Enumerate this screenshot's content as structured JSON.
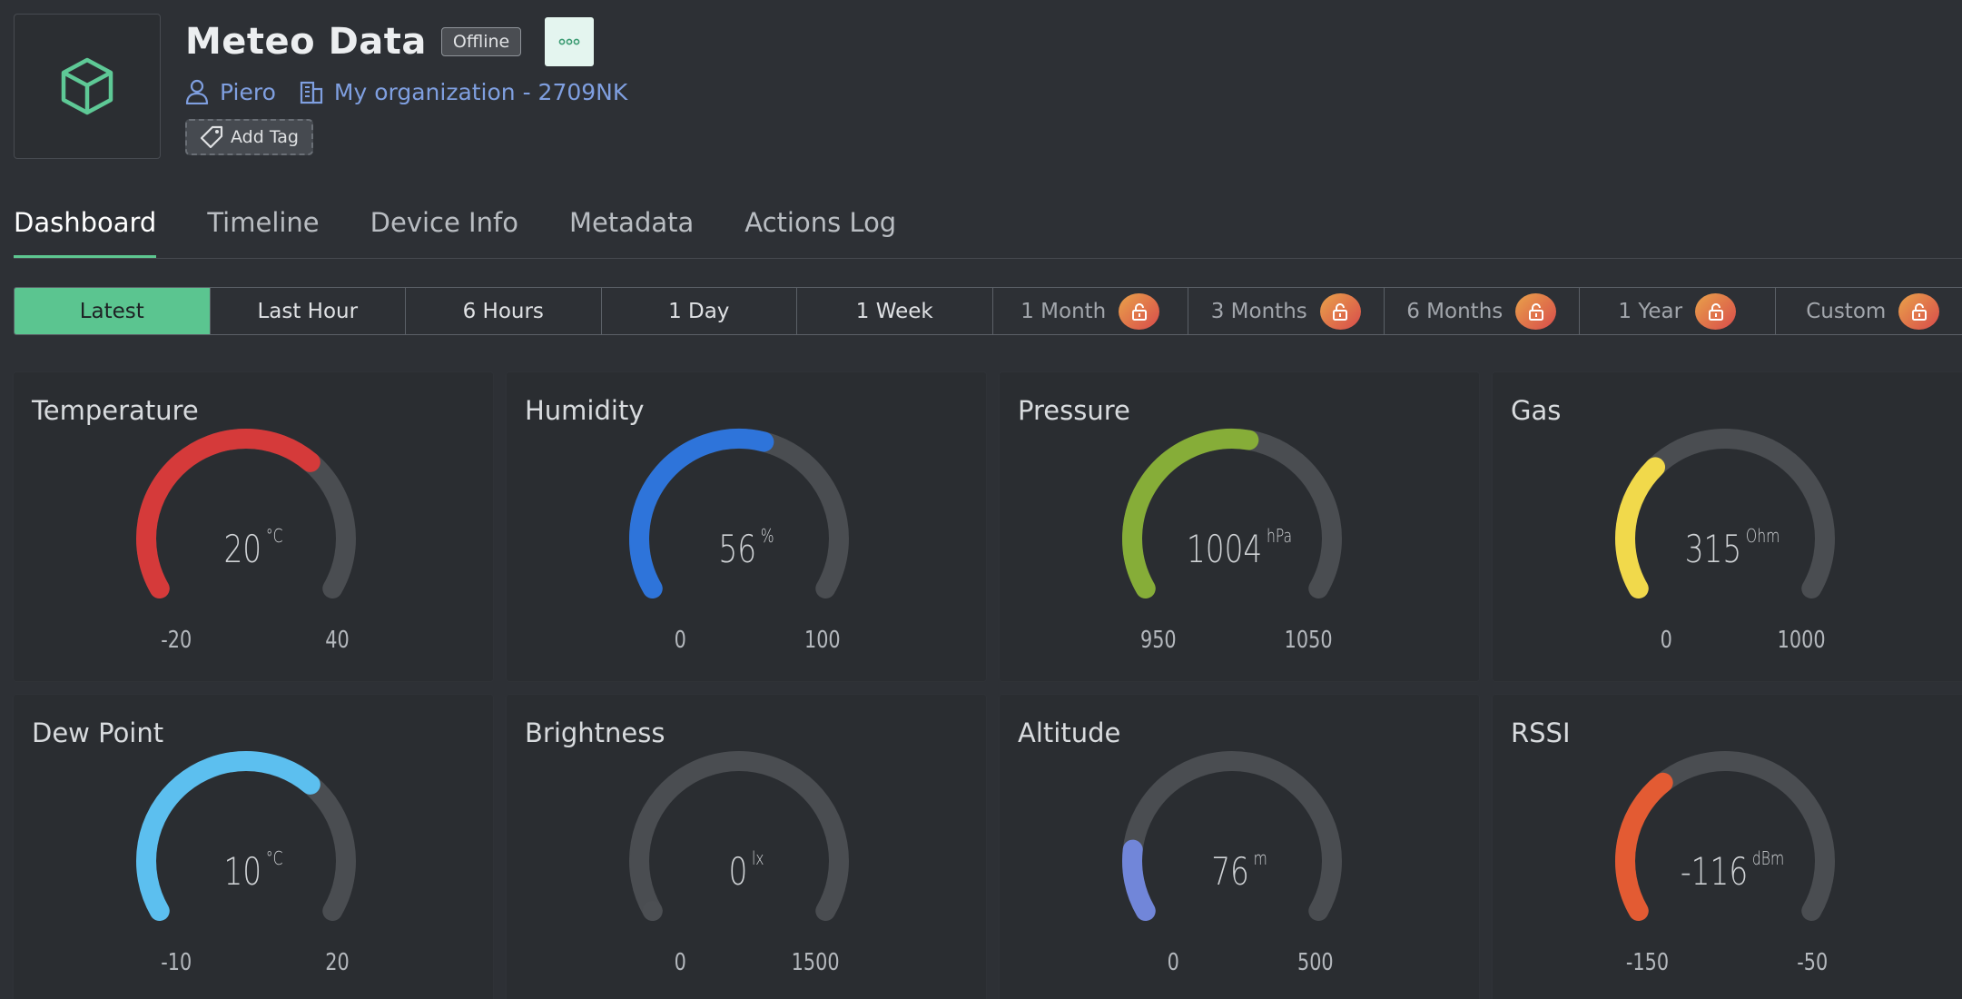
{
  "device": {
    "title": "Meteo Data",
    "status": "Offline",
    "owner": "Piero",
    "organization": "My organization - 2709NK",
    "add_tag_label": "Add Tag"
  },
  "tabs": [
    {
      "label": "Dashboard",
      "active": true
    },
    {
      "label": "Timeline"
    },
    {
      "label": "Device Info"
    },
    {
      "label": "Metadata"
    },
    {
      "label": "Actions Log"
    }
  ],
  "ranges": [
    {
      "label": "Latest",
      "active": true,
      "locked": false
    },
    {
      "label": "Last Hour",
      "locked": false
    },
    {
      "label": "6 Hours",
      "locked": false
    },
    {
      "label": "1 Day",
      "locked": false
    },
    {
      "label": "1 Week",
      "locked": false
    },
    {
      "label": "1 Month",
      "locked": true
    },
    {
      "label": "3 Months",
      "locked": true
    },
    {
      "label": "6 Months",
      "locked": true
    },
    {
      "label": "1 Year",
      "locked": true
    },
    {
      "label": "Custom",
      "locked": true
    }
  ],
  "gauges": [
    {
      "title": "Temperature",
      "value": "20",
      "unit": "°C",
      "min": "-20",
      "max": "40",
      "fraction": 0.667,
      "color": "#d53a3a"
    },
    {
      "title": "Humidity",
      "value": "56",
      "unit": "%",
      "min": "0",
      "max": "100",
      "fraction": 0.56,
      "color": "#2e74da"
    },
    {
      "title": "Pressure",
      "value": "1004",
      "unit": "hPa",
      "min": "950",
      "max": "1050",
      "fraction": 0.54,
      "color": "#86ad38"
    },
    {
      "title": "Gas",
      "value": "315",
      "unit": "Ohm",
      "min": "0",
      "max": "1000",
      "fraction": 0.315,
      "color": "#f1d94b"
    },
    {
      "title": "Dew Point",
      "value": "10",
      "unit": "°C",
      "min": "-10",
      "max": "20",
      "fraction": 0.667,
      "color": "#5cbfef"
    },
    {
      "title": "Brightness",
      "value": "0",
      "unit": "lx",
      "min": "0",
      "max": "1500",
      "fraction": 0.0,
      "color": "#4c4f53"
    },
    {
      "title": "Altitude",
      "value": "76",
      "unit": "m",
      "min": "0",
      "max": "500",
      "fraction": 0.152,
      "color": "#7186d9"
    },
    {
      "title": "RSSI",
      "value": "-116",
      "unit": "dBm",
      "min": "-150",
      "max": "-50",
      "fraction": 0.34,
      "color": "#e35b33"
    }
  ],
  "colors": {
    "accent": "#5bc590",
    "link": "#7f9fe0",
    "track": "#4a4d51",
    "background": "#2d3035"
  },
  "icons": {
    "device": "cube-icon",
    "owner": "user-icon",
    "organization": "building-icon",
    "tag": "tag-icon",
    "more": "more-dots-icon",
    "lock": "lock-icon"
  }
}
